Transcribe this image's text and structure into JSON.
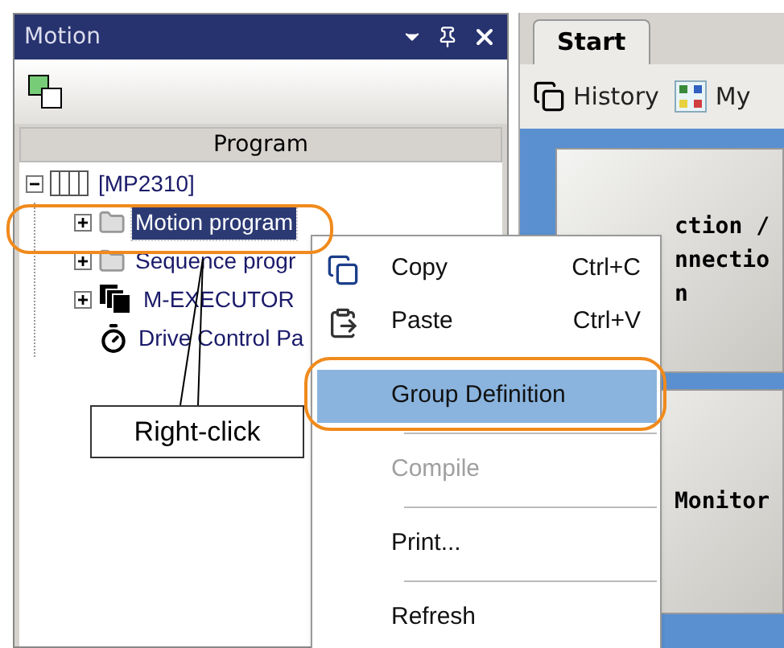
{
  "left_panel": {
    "title": "Motion",
    "column_header": "Program",
    "tree": [
      {
        "label": "[MP2310]",
        "kind": "controller",
        "expanded": true,
        "selected": false,
        "children": [
          {
            "label": "Motion program",
            "kind": "folder",
            "expanded": false,
            "selected": true
          },
          {
            "label": "Sequence progr",
            "kind": "folder",
            "expanded": false,
            "selected": false
          },
          {
            "label": "M-EXECUTOR",
            "kind": "executor",
            "expanded": false,
            "selected": false
          },
          {
            "label": "Drive Control Pa",
            "kind": "drive",
            "selected": false
          }
        ]
      }
    ]
  },
  "right_panel": {
    "tabs": [
      {
        "label": "Start",
        "selected": true
      }
    ],
    "toolbar": [
      {
        "label": "History"
      },
      {
        "label": "My"
      }
    ],
    "tiles": [
      {
        "lines": [
          "ction /",
          "nnectio",
          "n"
        ]
      },
      {
        "lines": [
          "Monitor"
        ]
      }
    ]
  },
  "context_menu": [
    {
      "kind": "item",
      "label": "Copy",
      "shortcut": "Ctrl+C",
      "disabled": false,
      "selected": false
    },
    {
      "kind": "item",
      "label": "Paste",
      "shortcut": "Ctrl+V",
      "disabled": false,
      "selected": false
    },
    {
      "kind": "item",
      "label": "Group Definition",
      "disabled": false,
      "selected": true
    },
    {
      "kind": "separator"
    },
    {
      "kind": "item",
      "label": "Compile",
      "disabled": true,
      "selected": false
    },
    {
      "kind": "separator"
    },
    {
      "kind": "item",
      "label": "Print...",
      "disabled": false,
      "selected": false
    },
    {
      "kind": "separator"
    },
    {
      "kind": "item",
      "label": "Refresh",
      "disabled": false,
      "selected": false
    }
  ],
  "callout": {
    "text": "Right-click"
  }
}
